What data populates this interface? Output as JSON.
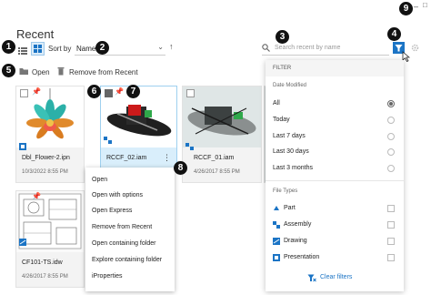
{
  "window": {
    "minimize_glyph": "–",
    "restore_glyph": "□"
  },
  "header": {
    "title": "Recent"
  },
  "toolbar": {
    "sort_label": "Sort by",
    "sort_value": "Name",
    "search_placeholder": "Search recent by name",
    "open_label": "Open",
    "remove_label": "Remove from Recent"
  },
  "callouts": [
    "1",
    "2",
    "3",
    "4",
    "5",
    "6",
    "7",
    "8",
    "9"
  ],
  "files": [
    {
      "name": "Dbl_Flower-2.ipn",
      "date": "10/3/2022 8:55 PM"
    },
    {
      "name": "RCCF_02.iam",
      "date": ""
    },
    {
      "name": "RCCF_01.iam",
      "date": "4/26/2017 8:55 PM"
    },
    {
      "name": "CF101-TS.idw",
      "date": "4/26/2017 8:55 PM"
    }
  ],
  "context_menu": {
    "items": [
      "Open",
      "Open with options",
      "Open Express",
      "Remove from Recent",
      "Open containing folder",
      "Explore containing folder",
      "iProperties"
    ]
  },
  "filter": {
    "title": "FILTER",
    "date_label": "Date Modified",
    "date_options": [
      "All",
      "Today",
      "Last 7 days",
      "Last 30 days",
      "Last 3 months"
    ],
    "selected_date": "All",
    "types_label": "File Types",
    "type_options": [
      "Part",
      "Assembly",
      "Drawing",
      "Presentation"
    ],
    "clear_label": "Clear filters"
  },
  "colors": {
    "accent": "#1b74c5",
    "selected_card": "#d9eefb"
  }
}
